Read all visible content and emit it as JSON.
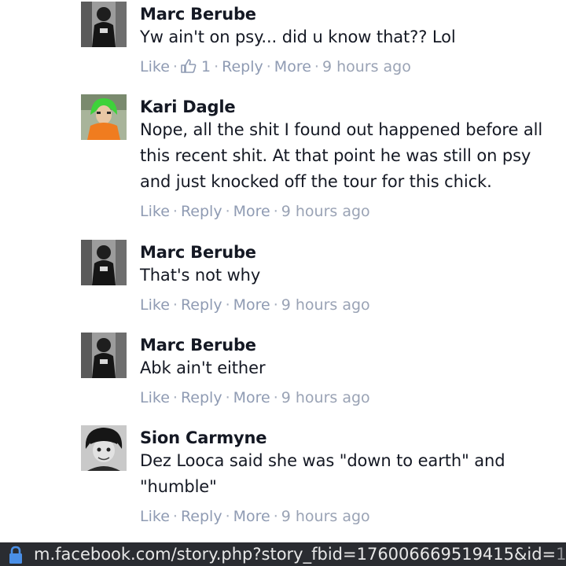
{
  "comments": [
    {
      "author": "Marc Berube",
      "text": "Yw ain't on psy... did u know that?? Lol",
      "actions": {
        "like": "Like",
        "like_count": "1",
        "reply": "Reply",
        "more": "More",
        "time": "9 hours ago"
      }
    },
    {
      "author": "Kari Dagle",
      "text": "Nope, all the shit I found out happened before all this recent shit. At that point he was still on psy and just knocked off the tour for this chick.",
      "actions": {
        "like": "Like",
        "reply": "Reply",
        "more": "More",
        "time": "9 hours ago"
      }
    },
    {
      "author": "Marc Berube",
      "text": "That's not why",
      "actions": {
        "like": "Like",
        "reply": "Reply",
        "more": "More",
        "time": "9 hours ago"
      }
    },
    {
      "author": "Marc Berube",
      "text": "Abk ain't either",
      "actions": {
        "like": "Like",
        "reply": "Reply",
        "more": "More",
        "time": "9 hours ago"
      }
    },
    {
      "author": "Sion Carmyne",
      "text": "Dez Looca said she was \"down to earth\" and \"humble\"",
      "actions": {
        "like": "Like",
        "reply": "Reply",
        "more": "More",
        "time": "9 hours ago"
      }
    }
  ],
  "urlbar": {
    "url": "m.facebook.com/story.php?story_fbid=176006669519415&id=",
    "url_fade": "10",
    "lock_icon": "lock-icon"
  },
  "colors": {
    "action_text": "#8f9bb3",
    "name_text": "#141823",
    "urlbar_bg": "#2a2c31",
    "lock": "#4a8fe7"
  }
}
